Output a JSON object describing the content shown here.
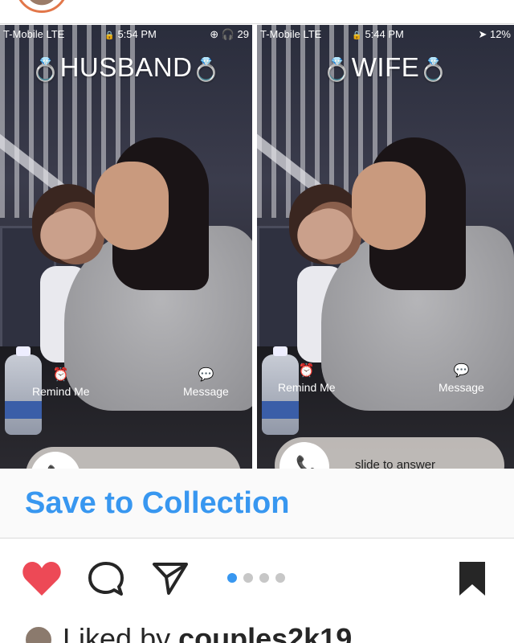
{
  "post": {
    "left_phone": {
      "status_carrier": "T-Mobile  LTE",
      "status_time": "5:54 PM",
      "status_right": "29",
      "caller_name": "HUSBAND",
      "remind_label": "Remind Me",
      "message_label": "Message"
    },
    "right_phone": {
      "status_carrier": "T-Mobile  LTE",
      "status_time": "5:44 PM",
      "status_right": "12%",
      "caller_name": "WIFE",
      "remind_label": "Remind Me",
      "message_label": "Message",
      "slide_text": "slide to answer"
    },
    "ring_glyph": "💍"
  },
  "save_bar": {
    "label": "Save to Collection"
  },
  "actions": {
    "icons": [
      "heart-icon",
      "comment-icon",
      "share-icon",
      "bookmark-icon"
    ],
    "carousel_pages": 4,
    "carousel_active": 1,
    "heart_color": "#ed4956",
    "accent_color": "#3897f0"
  },
  "likes": {
    "prefix": "Liked by ",
    "user": "couples2k19"
  }
}
